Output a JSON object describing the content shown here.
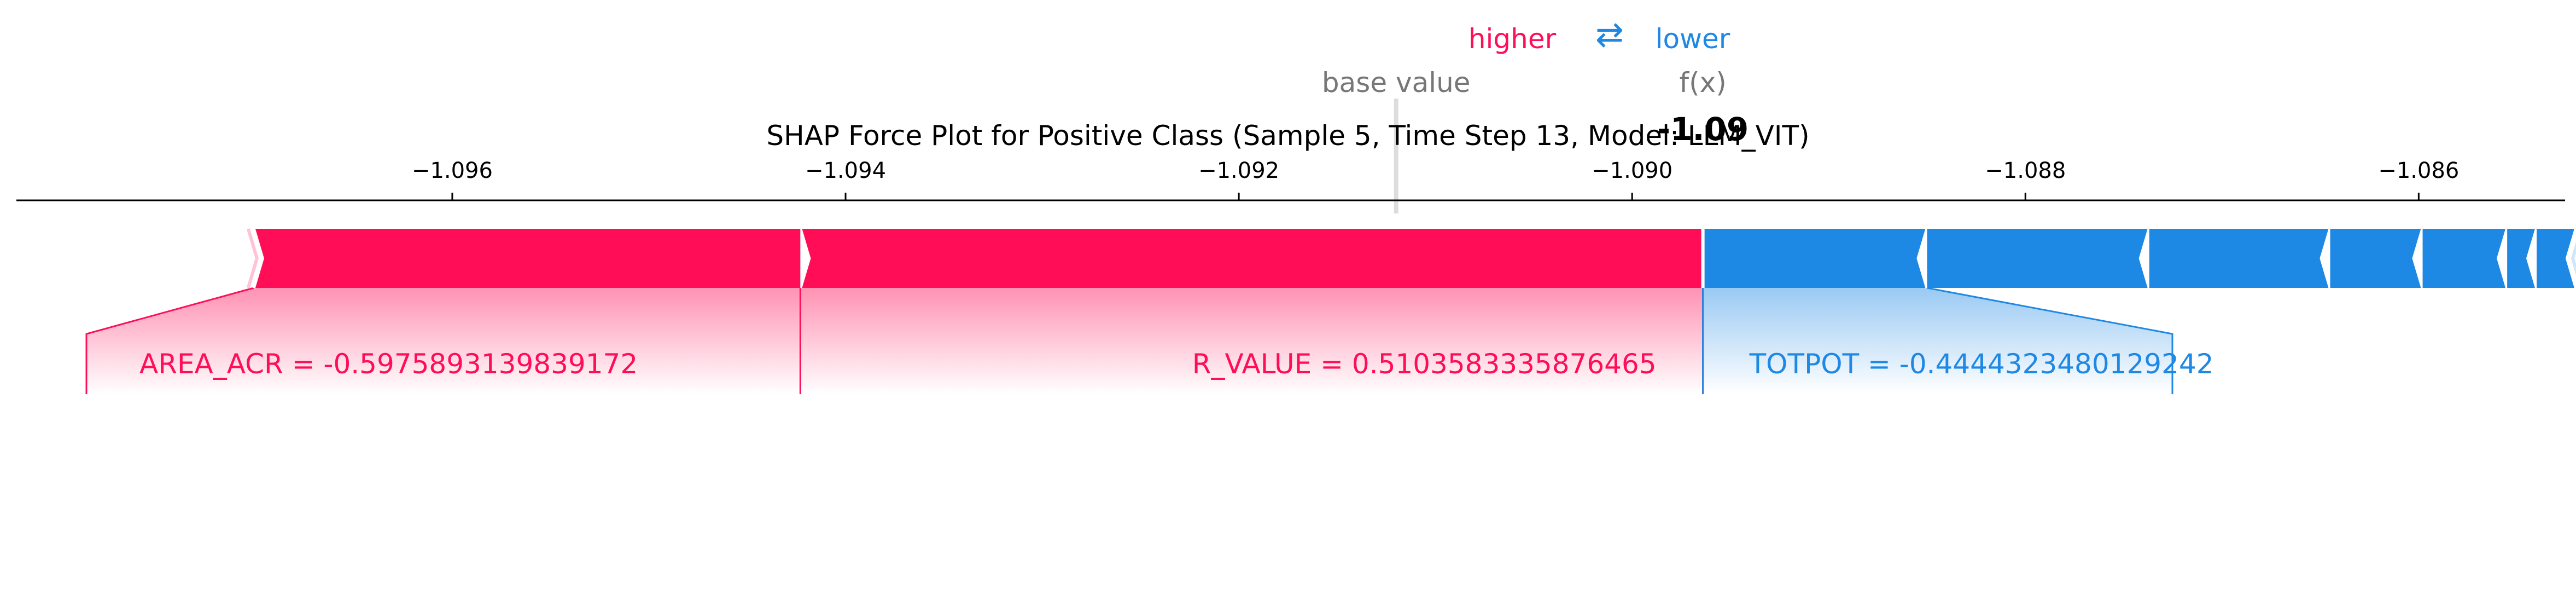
{
  "chart_data": {
    "type": "force",
    "title": "SHAP Force Plot for Positive Class (Sample 5, Time Step 13, Model: LLM_VIT)",
    "legend": {
      "higher": "higher",
      "arrows": "⇄",
      "lower": "lower"
    },
    "base_value_label": "base value",
    "base_value": -1.0912,
    "fx_label": "f(x)",
    "fx_value_text": "-1.09",
    "fx_value": -1.08964,
    "xlim": [
      -1.0983,
      -1.0852
    ],
    "ticks": [
      {
        "value": -1.096,
        "label": "−1.096"
      },
      {
        "value": -1.094,
        "label": "−1.094"
      },
      {
        "value": -1.092,
        "label": "−1.092"
      },
      {
        "value": -1.09,
        "label": "−1.090"
      },
      {
        "value": -1.088,
        "label": "−1.088"
      },
      {
        "value": -1.086,
        "label": "−1.086"
      }
    ],
    "positive_features": [
      {
        "label": "R_VALUE = 0.5103583335876465",
        "start": -1.09423,
        "end": -1.08964
      },
      {
        "label": "AREA_ACR = -0.5975893139839172",
        "start": -1.09701,
        "end": -1.09423
      }
    ],
    "negative_features": [
      {
        "label": "TOTPOT = -0.4444323480129242",
        "start": -1.08964,
        "end": -1.0885
      },
      {
        "label": "",
        "start": -1.0885,
        "end": -1.08737
      },
      {
        "label": "",
        "start": -1.08737,
        "end": -1.08645
      },
      {
        "label": "",
        "start": -1.08645,
        "end": -1.08598
      },
      {
        "label": "",
        "start": -1.08598,
        "end": -1.08555
      },
      {
        "label": "",
        "start": -1.08555,
        "end": -1.0854
      },
      {
        "label": "",
        "start": -1.0854,
        "end": -1.0852
      }
    ],
    "colors": {
      "positive": "#ff0d57",
      "negative": "#1e88e5",
      "axis": "#000000",
      "muted": "#777777"
    }
  }
}
